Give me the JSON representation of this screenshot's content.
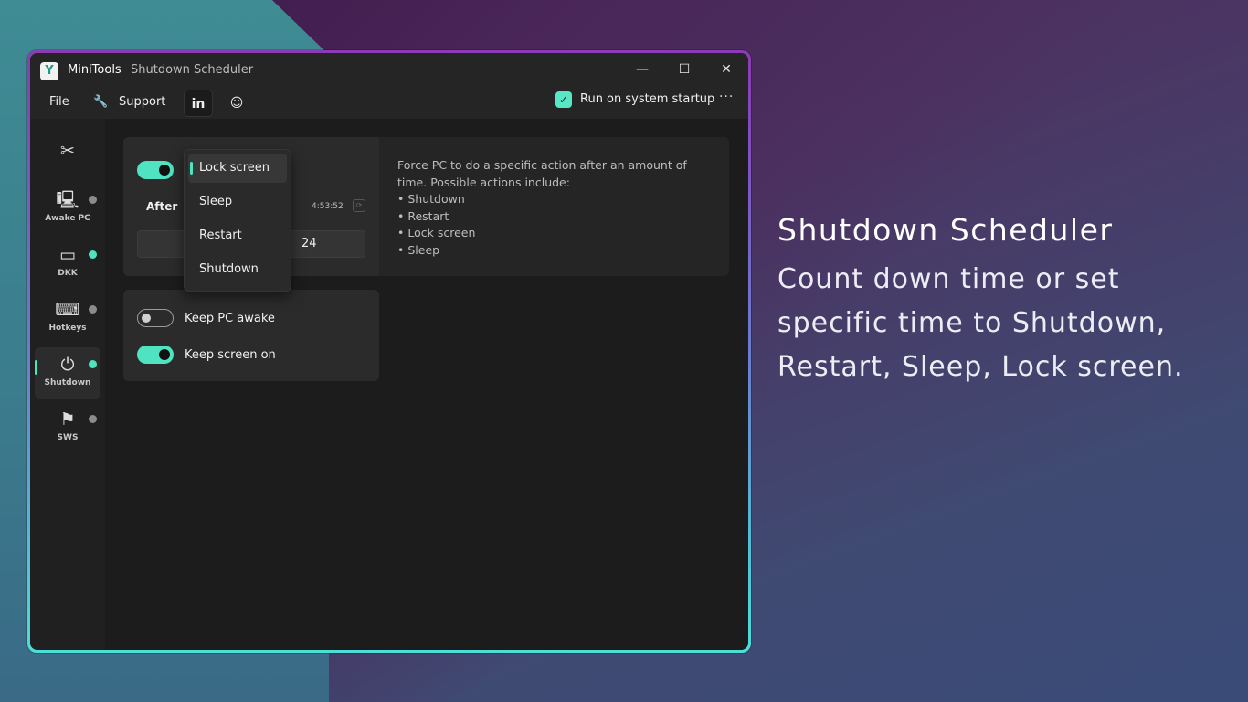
{
  "window": {
    "app_name": "MiniTools",
    "subtitle": "Shutdown Scheduler",
    "logo_glyph": "Y",
    "controls": {
      "minimize": "—",
      "maximize": "☐",
      "close": "✕"
    }
  },
  "menubar": {
    "file": "File",
    "support": "Support",
    "support_icon": "🔧",
    "linkedin_icon": "in",
    "ai_icon": "☺",
    "startup_check": "✓",
    "startup_label": "Run on system startup",
    "more": "···"
  },
  "sidebar": {
    "items": [
      {
        "label": "",
        "icon": "✂",
        "dot": "none"
      },
      {
        "label": "Awake PC",
        "icon": "🖳",
        "dot": "off"
      },
      {
        "label": "DKK",
        "icon": "▭",
        "dot": "on"
      },
      {
        "label": "Hotkeys",
        "icon": "⌨",
        "dot": "off"
      },
      {
        "label": "Shutdown",
        "icon": "⏻",
        "dot": "on"
      },
      {
        "label": "SWS",
        "icon": "⚑",
        "dot": "off"
      }
    ]
  },
  "scheduler": {
    "after_label": "After",
    "time_readout": "4:53:52",
    "refresh_icon": "⟳",
    "number_value": "24",
    "description": "Force PC to do a specific action after an amount of time. Possible actions include:",
    "actions_list": [
      "• Shutdown",
      "• Restart",
      "• Lock screen",
      "• Sleep"
    ]
  },
  "dropdown": {
    "options": [
      "Lock screen",
      "Sleep",
      "Restart",
      "Shutdown"
    ],
    "selected": "Lock screen"
  },
  "options_card": {
    "keep_pc_awake": "Keep PC awake",
    "keep_screen_on": "Keep screen on"
  },
  "promo": {
    "title": "Shutdown Scheduler",
    "text": "Count down time or set specific time to Shutdown, Restart, Sleep, Lock screen."
  },
  "colors": {
    "accent": "#4fe3c1",
    "window_bg": "#1c1c1c",
    "card_bg": "#2b2b2b"
  }
}
